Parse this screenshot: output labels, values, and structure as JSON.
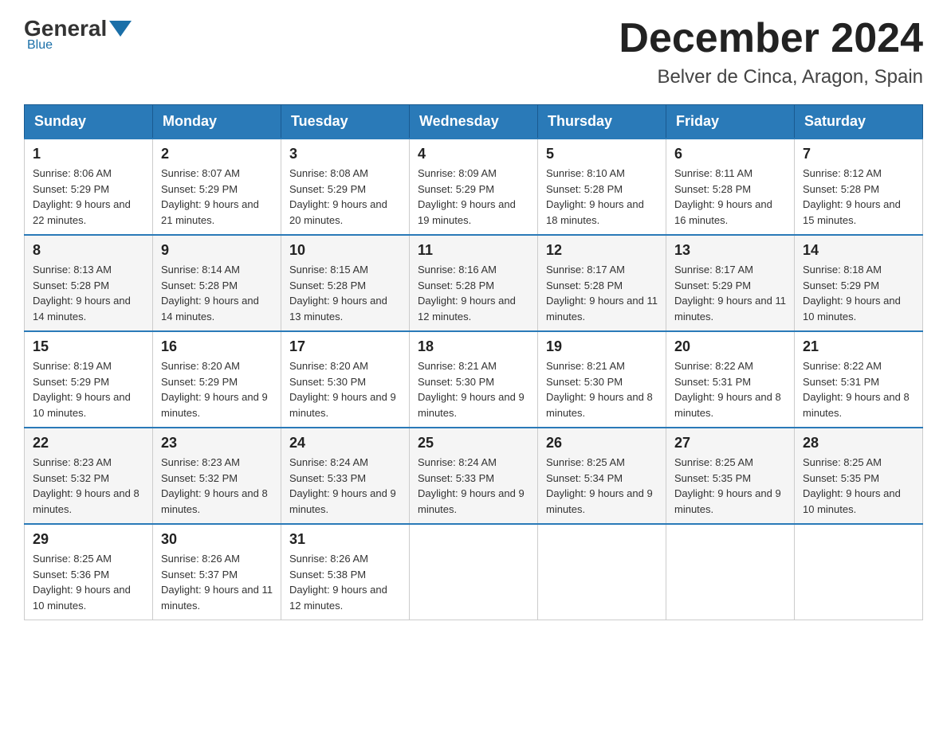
{
  "logo": {
    "general": "General",
    "blue": "Blue"
  },
  "header": {
    "month": "December 2024",
    "location": "Belver de Cinca, Aragon, Spain"
  },
  "days_of_week": [
    "Sunday",
    "Monday",
    "Tuesday",
    "Wednesday",
    "Thursday",
    "Friday",
    "Saturday"
  ],
  "weeks": [
    [
      {
        "day": "1",
        "sunrise": "8:06 AM",
        "sunset": "5:29 PM",
        "daylight": "9 hours and 22 minutes."
      },
      {
        "day": "2",
        "sunrise": "8:07 AM",
        "sunset": "5:29 PM",
        "daylight": "9 hours and 21 minutes."
      },
      {
        "day": "3",
        "sunrise": "8:08 AM",
        "sunset": "5:29 PM",
        "daylight": "9 hours and 20 minutes."
      },
      {
        "day": "4",
        "sunrise": "8:09 AM",
        "sunset": "5:29 PM",
        "daylight": "9 hours and 19 minutes."
      },
      {
        "day": "5",
        "sunrise": "8:10 AM",
        "sunset": "5:28 PM",
        "daylight": "9 hours and 18 minutes."
      },
      {
        "day": "6",
        "sunrise": "8:11 AM",
        "sunset": "5:28 PM",
        "daylight": "9 hours and 16 minutes."
      },
      {
        "day": "7",
        "sunrise": "8:12 AM",
        "sunset": "5:28 PM",
        "daylight": "9 hours and 15 minutes."
      }
    ],
    [
      {
        "day": "8",
        "sunrise": "8:13 AM",
        "sunset": "5:28 PM",
        "daylight": "9 hours and 14 minutes."
      },
      {
        "day": "9",
        "sunrise": "8:14 AM",
        "sunset": "5:28 PM",
        "daylight": "9 hours and 14 minutes."
      },
      {
        "day": "10",
        "sunrise": "8:15 AM",
        "sunset": "5:28 PM",
        "daylight": "9 hours and 13 minutes."
      },
      {
        "day": "11",
        "sunrise": "8:16 AM",
        "sunset": "5:28 PM",
        "daylight": "9 hours and 12 minutes."
      },
      {
        "day": "12",
        "sunrise": "8:17 AM",
        "sunset": "5:28 PM",
        "daylight": "9 hours and 11 minutes."
      },
      {
        "day": "13",
        "sunrise": "8:17 AM",
        "sunset": "5:29 PM",
        "daylight": "9 hours and 11 minutes."
      },
      {
        "day": "14",
        "sunrise": "8:18 AM",
        "sunset": "5:29 PM",
        "daylight": "9 hours and 10 minutes."
      }
    ],
    [
      {
        "day": "15",
        "sunrise": "8:19 AM",
        "sunset": "5:29 PM",
        "daylight": "9 hours and 10 minutes."
      },
      {
        "day": "16",
        "sunrise": "8:20 AM",
        "sunset": "5:29 PM",
        "daylight": "9 hours and 9 minutes."
      },
      {
        "day": "17",
        "sunrise": "8:20 AM",
        "sunset": "5:30 PM",
        "daylight": "9 hours and 9 minutes."
      },
      {
        "day": "18",
        "sunrise": "8:21 AM",
        "sunset": "5:30 PM",
        "daylight": "9 hours and 9 minutes."
      },
      {
        "day": "19",
        "sunrise": "8:21 AM",
        "sunset": "5:30 PM",
        "daylight": "9 hours and 8 minutes."
      },
      {
        "day": "20",
        "sunrise": "8:22 AM",
        "sunset": "5:31 PM",
        "daylight": "9 hours and 8 minutes."
      },
      {
        "day": "21",
        "sunrise": "8:22 AM",
        "sunset": "5:31 PM",
        "daylight": "9 hours and 8 minutes."
      }
    ],
    [
      {
        "day": "22",
        "sunrise": "8:23 AM",
        "sunset": "5:32 PM",
        "daylight": "9 hours and 8 minutes."
      },
      {
        "day": "23",
        "sunrise": "8:23 AM",
        "sunset": "5:32 PM",
        "daylight": "9 hours and 8 minutes."
      },
      {
        "day": "24",
        "sunrise": "8:24 AM",
        "sunset": "5:33 PM",
        "daylight": "9 hours and 9 minutes."
      },
      {
        "day": "25",
        "sunrise": "8:24 AM",
        "sunset": "5:33 PM",
        "daylight": "9 hours and 9 minutes."
      },
      {
        "day": "26",
        "sunrise": "8:25 AM",
        "sunset": "5:34 PM",
        "daylight": "9 hours and 9 minutes."
      },
      {
        "day": "27",
        "sunrise": "8:25 AM",
        "sunset": "5:35 PM",
        "daylight": "9 hours and 9 minutes."
      },
      {
        "day": "28",
        "sunrise": "8:25 AM",
        "sunset": "5:35 PM",
        "daylight": "9 hours and 10 minutes."
      }
    ],
    [
      {
        "day": "29",
        "sunrise": "8:25 AM",
        "sunset": "5:36 PM",
        "daylight": "9 hours and 10 minutes."
      },
      {
        "day": "30",
        "sunrise": "8:26 AM",
        "sunset": "5:37 PM",
        "daylight": "9 hours and 11 minutes."
      },
      {
        "day": "31",
        "sunrise": "8:26 AM",
        "sunset": "5:38 PM",
        "daylight": "9 hours and 12 minutes."
      },
      null,
      null,
      null,
      null
    ]
  ]
}
